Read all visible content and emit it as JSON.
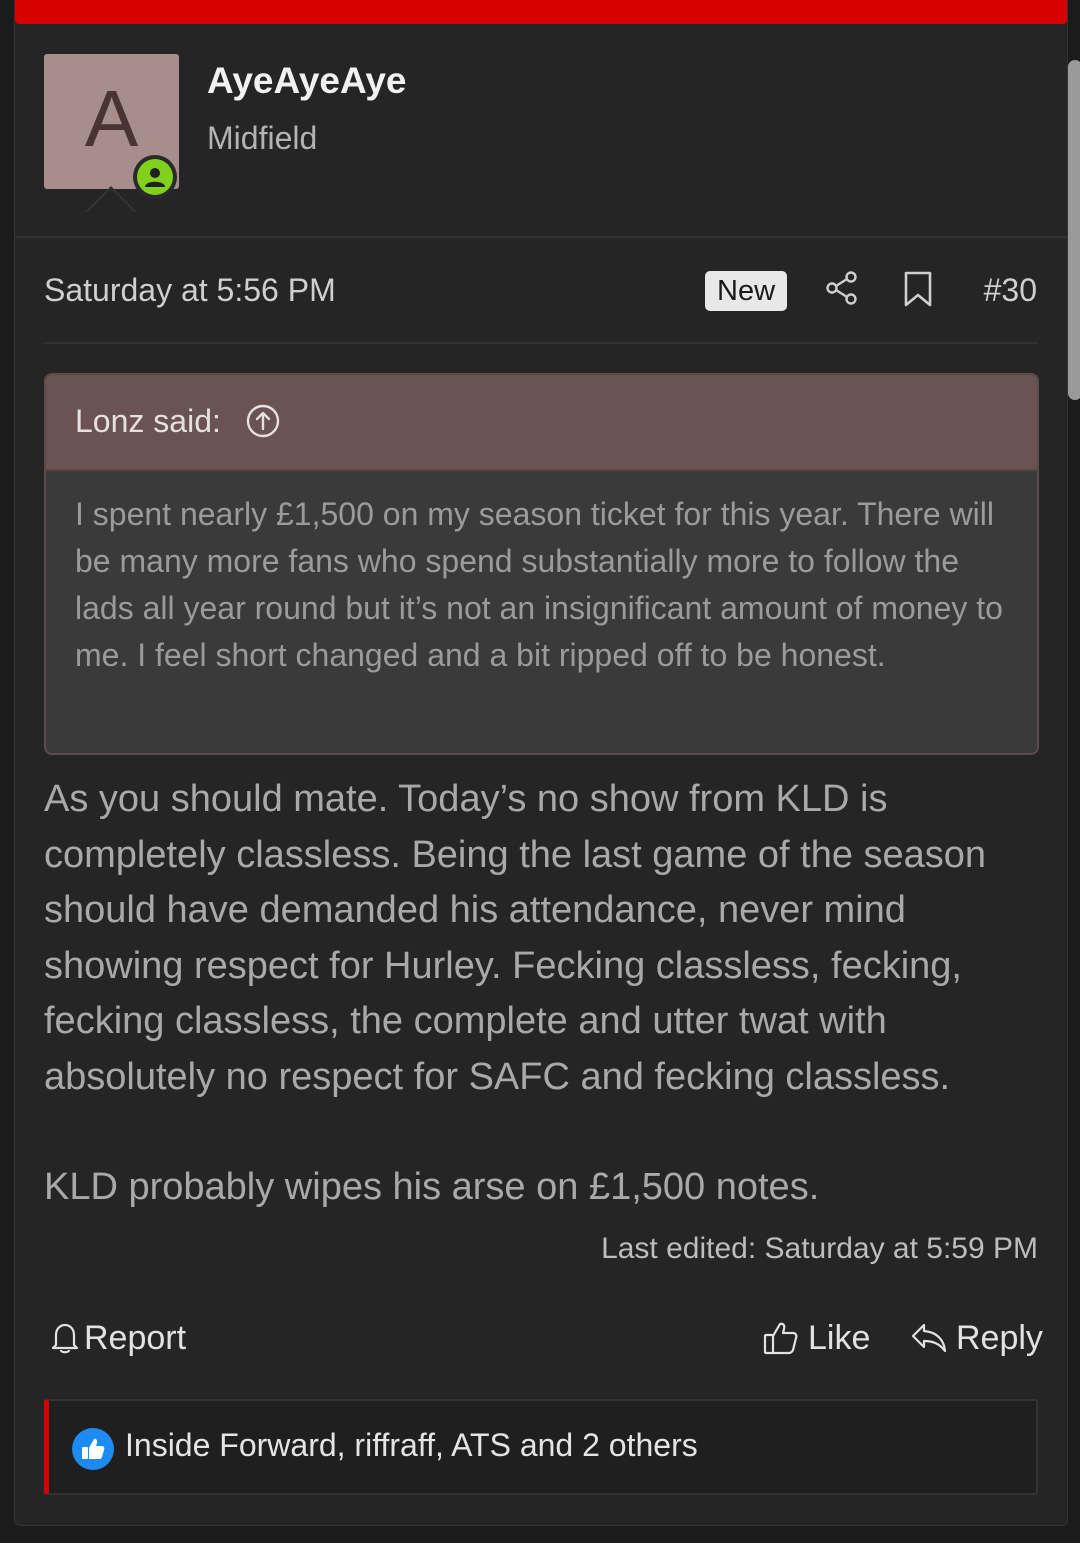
{
  "post": {
    "accent_color": "#d90000",
    "user": {
      "avatar_letter": "A",
      "avatar_bg": "#a88d8d",
      "name": "AyeAyeAye",
      "title": "Midfield",
      "status_icon": "online-user-icon"
    },
    "meta": {
      "date": "Saturday at 5:56 PM",
      "new_label": "New",
      "share_icon": "share-icon",
      "bookmark_icon": "bookmark-icon",
      "number": "#30"
    },
    "quote": {
      "author": "Lonz said:",
      "jump_icon": "arrow-up-circle-icon",
      "text": "I spent nearly £1,500 on my season ticket for this year. There will be many more fans who spend substantially more to follow the lads all year round but it’s not an insignificant amount of money to me. I feel short changed and a bit ripped off to be honest."
    },
    "message": {
      "paragraph1": "As you should mate. Today’s no show from KLD is completely classless. Being the last game of the season should have demanded his attendance, never mind showing respect for Hurley. Fecking classless, fecking, fecking classless, the complete and utter twat with absolutely no respect for SAFC and fecking classless.",
      "paragraph2": "KLD probably wipes his arse on £1,500 notes."
    },
    "last_edited": "Last edited: Saturday at 5:59 PM",
    "actions": {
      "report_label": "Report",
      "like_label": "Like",
      "reply_label": "Reply"
    },
    "reactions": {
      "icon": "thumbs-up-icon",
      "text": "Inside Forward, riffraff, ATS and 2 others"
    }
  }
}
